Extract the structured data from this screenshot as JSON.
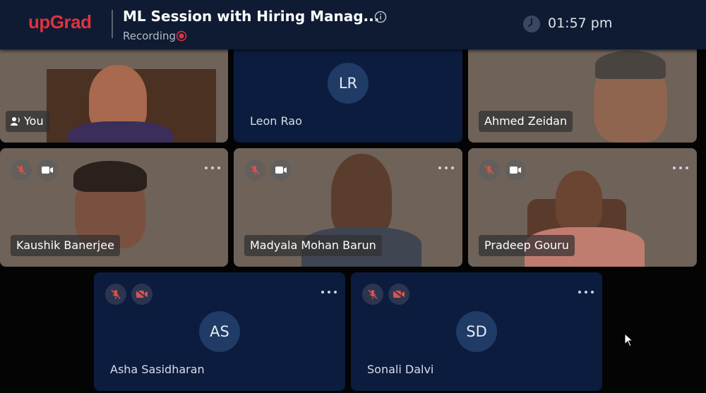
{
  "header": {
    "logo": "upGrad",
    "session_title": "ML Session with Hiring Manag...",
    "status": "Recording",
    "time": "01:57 pm",
    "brand_color": "#e0323d",
    "background_color": "#0e1b33"
  },
  "participants": [
    {
      "name": "You",
      "video": true,
      "icon": "speaker-icon"
    },
    {
      "name": "Leon Rao",
      "initials": "LR",
      "video": false
    },
    {
      "name": "Ahmed Zeidan",
      "video": true
    },
    {
      "name": "Kaushik Banerjee",
      "video": true,
      "mic": "muted",
      "camera": "on"
    },
    {
      "name": "Madyala Mohan Barun",
      "video": true,
      "mic": "muted",
      "camera": "on"
    },
    {
      "name": "Pradeep Gouru",
      "video": true,
      "mic": "muted",
      "camera": "on"
    },
    {
      "name": "Asha Sasidharan",
      "initials": "AS",
      "video": false,
      "mic": "muted",
      "camera": "off"
    },
    {
      "name": "Sonali Dalvi",
      "initials": "SD",
      "video": false,
      "mic": "muted",
      "camera": "off"
    }
  ],
  "colors": {
    "tile_dark": "#0b1c3e",
    "avatar_circle": "#1f3b66",
    "muted_icon": "#d9534f"
  }
}
